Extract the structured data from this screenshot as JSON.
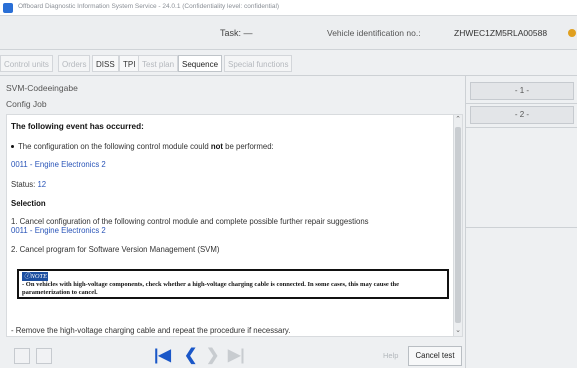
{
  "window": {
    "title": "Offboard Diagnostic Information System Service - 24.0.1 (Confidentiality level: confidential)"
  },
  "header": {
    "task_label": "Task:  —",
    "vin_label": "Vehicle identification no.:",
    "vin_value": "ZHWEC1ZM5RLA00588"
  },
  "tabs": [
    {
      "label": "Control units",
      "enabled": false
    },
    {
      "label": "Orders",
      "enabled": false
    },
    {
      "label": "DISS",
      "enabled": true
    },
    {
      "label": "TPI",
      "enabled": true
    },
    {
      "label": "Test plan",
      "enabled": false
    },
    {
      "label": "Sequence",
      "enabled": true,
      "active": true
    },
    {
      "label": "Special functions",
      "enabled": false
    }
  ],
  "main": {
    "heading1": "SVM-Codeeingabe",
    "heading2": "Config Job",
    "content": {
      "event_title": "The following event has occurred:",
      "config_line_pre": "The configuration on the following control module could ",
      "config_line_bold": "not",
      "config_line_post": " be performed:",
      "module_link": "0011 - Engine Electronics 2",
      "status_label": "Status: ",
      "status_value": "12",
      "selection_title": "Selection",
      "option1": "1. Cancel configuration of the following control module and complete possible further repair suggestions",
      "option1_link": "0011 - Engine Electronics 2",
      "option2": "2. Cancel program for Software Version Management (SVM)",
      "note_tag": "NOTE",
      "note_text": "- On vehicles with high-voltage components, check whether a high-voltage charging cable is connected. In some cases, this may cause the parameterization to cancel.",
      "remove_line": "- Remove the high-voltage charging cable and repeat the procedure if necessary."
    }
  },
  "toolbar": {
    "help_label": "Help",
    "cancel_label": "Cancel test"
  },
  "right_panel": {
    "buttons": [
      "- 1 -",
      "- 2 -"
    ]
  }
}
